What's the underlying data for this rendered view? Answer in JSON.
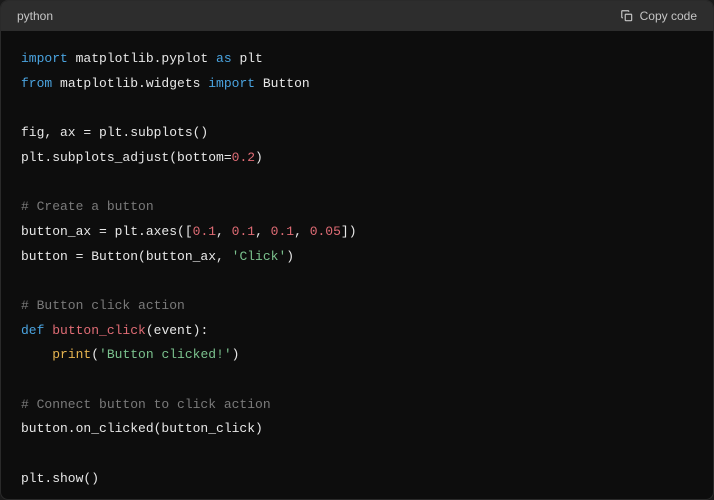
{
  "header": {
    "language": "python",
    "copy_label": "Copy code"
  },
  "code": {
    "l1_kw1": "import",
    "l1_mod": " matplotlib.pyplot ",
    "l1_kw2": "as",
    "l1_alias": " plt",
    "l2_kw1": "from",
    "l2_mod": " matplotlib.widgets ",
    "l2_kw2": "import",
    "l2_name": " Button",
    "l4": "fig, ax = plt.subplots()",
    "l5_a": "plt.subplots_adjust(bottom=",
    "l5_num": "0.2",
    "l5_b": ")",
    "l7_com": "# Create a button",
    "l8_a": "button_ax = plt.axes([",
    "l8_n1": "0.1",
    "l8_c1": ", ",
    "l8_n2": "0.1",
    "l8_c2": ", ",
    "l8_n3": "0.1",
    "l8_c3": ", ",
    "l8_n4": "0.05",
    "l8_b": "])",
    "l9_a": "button = Button(button_ax, ",
    "l9_str": "'Click'",
    "l9_b": ")",
    "l11_com": "# Button click action",
    "l12_kw": "def",
    "l12_sp": " ",
    "l12_fn": "button_click",
    "l12_args": "(event):",
    "l13_indent": "    ",
    "l13_fn": "print",
    "l13_a": "(",
    "l13_str": "'Button clicked!'",
    "l13_b": ")",
    "l15_com": "# Connect button to click action",
    "l16": "button.on_clicked(button_click)",
    "l18": "plt.show()"
  }
}
